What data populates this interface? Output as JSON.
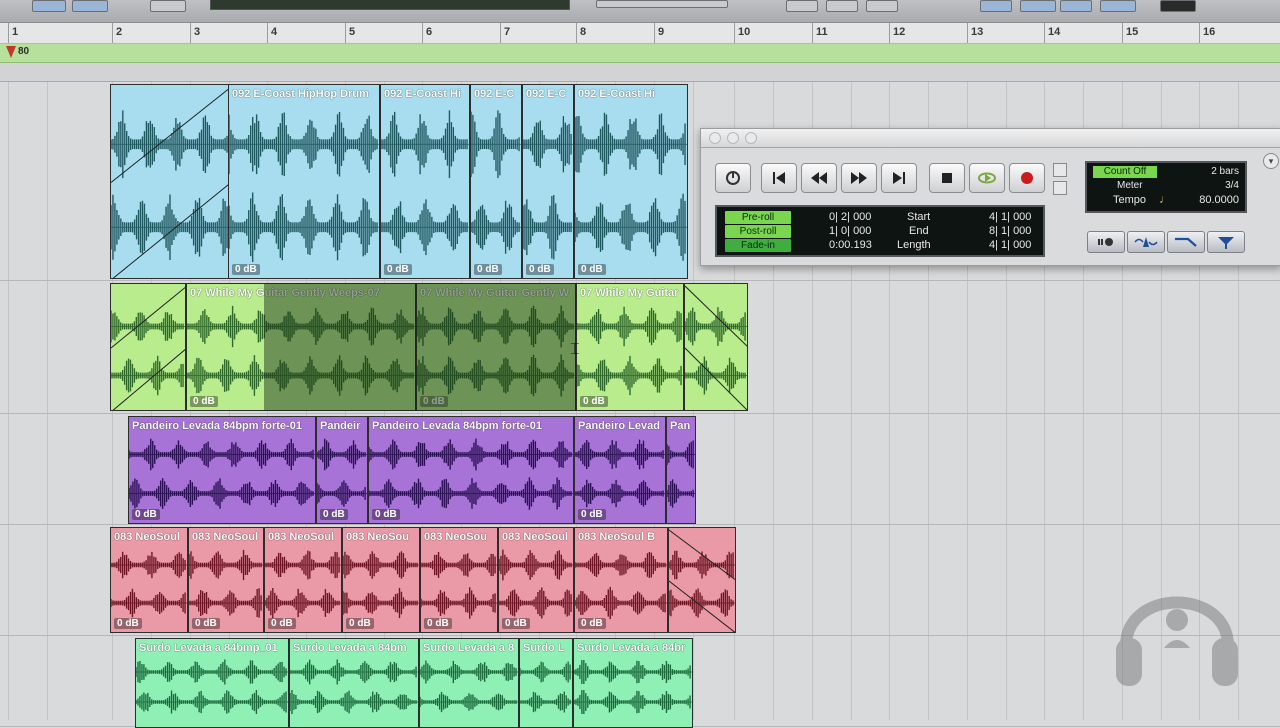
{
  "ruler": {
    "bars": [
      "1",
      "2",
      "3",
      "4",
      "5",
      "6",
      "7",
      "8",
      "9",
      "10",
      "11",
      "12",
      "13",
      "14",
      "15",
      "16"
    ]
  },
  "tempo_track": {
    "value": "80"
  },
  "tracks": [
    {
      "color": "#a8dcef",
      "wave_color": "#1f5960",
      "clips": [
        {
          "name": "",
          "gain": ""
        },
        {
          "name": "092 E-Coast HipHop Drum",
          "gain": "0 dB"
        },
        {
          "name": "092 E-Coast Hi",
          "gain": "0 dB"
        },
        {
          "name": "092 E-C",
          "gain": "0 dB"
        },
        {
          "name": "092 E-C",
          "gain": "0 dB"
        },
        {
          "name": "092 E-Coast Hi",
          "gain": "0 dB"
        }
      ]
    },
    {
      "color": "#b8ec8c",
      "wave_color": "#2f6a2b",
      "clips": [
        {
          "name": "",
          "gain": ""
        },
        {
          "name": "07 While My Guitar Gently Weeps-07",
          "gain": "0 dB"
        },
        {
          "name": "07 While My Guitar Gently W",
          "gain": "0 dB"
        },
        {
          "name": "07 While My Guitar",
          "gain": "0 dB"
        },
        {
          "name": "",
          "gain": ""
        }
      ]
    },
    {
      "color": "#a773d6",
      "wave_color": "#2b1055",
      "clips": [
        {
          "name": "Pandeiro Levada 84bpm forte-01",
          "gain": "0 dB"
        },
        {
          "name": "Pandeir",
          "gain": "0 dB"
        },
        {
          "name": "Pandeiro Levada 84bpm forte-01",
          "gain": "0 dB"
        },
        {
          "name": "Pandeiro Levad",
          "gain": "0 dB"
        },
        {
          "name": "Pan",
          "gain": ""
        }
      ]
    },
    {
      "color": "#ea9aa7",
      "wave_color": "#6e1422",
      "clips": [
        {
          "name": "083 NeoSoul",
          "gain": "0 dB"
        },
        {
          "name": "083 NeoSoul",
          "gain": "0 dB"
        },
        {
          "name": "083 NeoSoul",
          "gain": "0 dB"
        },
        {
          "name": "083 NeoSou",
          "gain": "0 dB"
        },
        {
          "name": "083 NeoSou",
          "gain": "0 dB"
        },
        {
          "name": "083 NeoSoul",
          "gain": "0 dB"
        },
        {
          "name": "083 NeoSoul B",
          "gain": "0 dB"
        },
        {
          "name": "",
          "gain": ""
        }
      ]
    },
    {
      "color": "#8ff0b6",
      "wave_color": "#1c6b3d",
      "clips": [
        {
          "name": "Surdo Levada a 84bmp_01",
          "gain": ""
        },
        {
          "name": "Surdo Levada a 84bm",
          "gain": ""
        },
        {
          "name": "Surdo Levada a 8",
          "gain": ""
        },
        {
          "name": "Surdo L",
          "gain": ""
        },
        {
          "name": "Surdo Levada a 84br",
          "gain": ""
        }
      ]
    }
  ],
  "transport": {
    "counter": {
      "pre_roll": {
        "label": "Pre-roll",
        "value": "0| 2| 000"
      },
      "post_roll": {
        "label": "Post-roll",
        "value": "1| 0| 000"
      },
      "fade_in": {
        "label": "Fade-in",
        "value": "0:00.193"
      },
      "start": {
        "label": "Start",
        "value": "4| 1| 000"
      },
      "end": {
        "label": "End",
        "value": "8| 1| 000"
      },
      "length": {
        "label": "Length",
        "value": "4| 1| 000"
      }
    },
    "midi": {
      "count_off": "Count Off",
      "bars": "2 bars",
      "meter_label": "Meter",
      "meter_value": "3/4",
      "tempo_label": "Tempo",
      "tempo_value": "80.0000"
    }
  }
}
